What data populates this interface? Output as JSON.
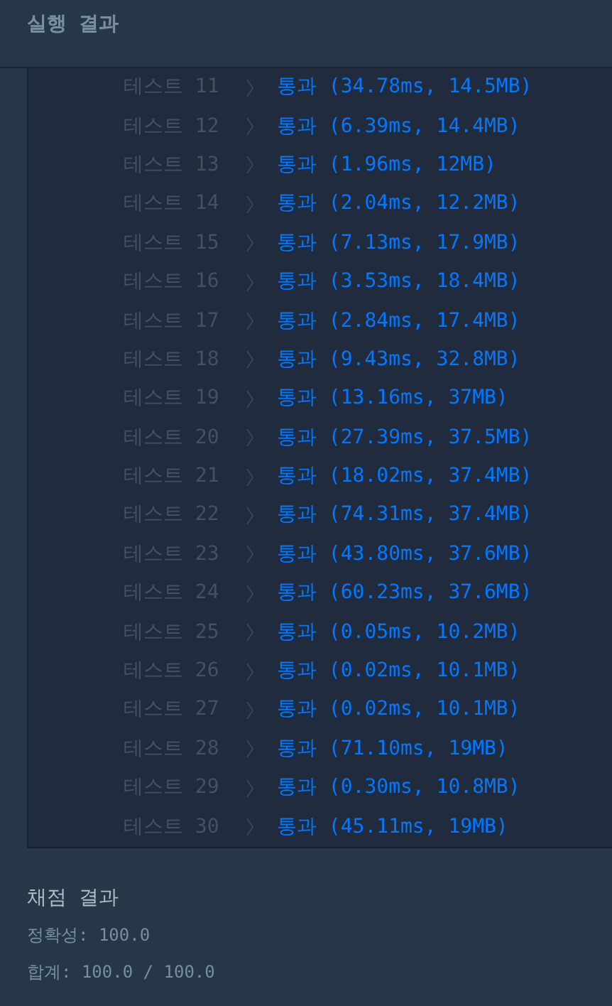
{
  "header": {
    "title": "실행 결과"
  },
  "tests": [
    {
      "label": "테스트 11",
      "result": "통과 (34.78ms, 14.5MB)"
    },
    {
      "label": "테스트 12",
      "result": "통과 (6.39ms, 14.4MB)"
    },
    {
      "label": "테스트 13",
      "result": "통과 (1.96ms, 12MB)"
    },
    {
      "label": "테스트 14",
      "result": "통과 (2.04ms, 12.2MB)"
    },
    {
      "label": "테스트 15",
      "result": "통과 (7.13ms, 17.9MB)"
    },
    {
      "label": "테스트 16",
      "result": "통과 (3.53ms, 18.4MB)"
    },
    {
      "label": "테스트 17",
      "result": "통과 (2.84ms, 17.4MB)"
    },
    {
      "label": "테스트 18",
      "result": "통과 (9.43ms, 32.8MB)"
    },
    {
      "label": "테스트 19",
      "result": "통과 (13.16ms, 37MB)"
    },
    {
      "label": "테스트 20",
      "result": "통과 (27.39ms, 37.5MB)"
    },
    {
      "label": "테스트 21",
      "result": "통과 (18.02ms, 37.4MB)"
    },
    {
      "label": "테스트 22",
      "result": "통과 (74.31ms, 37.4MB)"
    },
    {
      "label": "테스트 23",
      "result": "통과 (43.80ms, 37.6MB)"
    },
    {
      "label": "테스트 24",
      "result": "통과 (60.23ms, 37.6MB)"
    },
    {
      "label": "테스트 25",
      "result": "통과 (0.05ms, 10.2MB)"
    },
    {
      "label": "테스트 26",
      "result": "통과 (0.02ms, 10.1MB)"
    },
    {
      "label": "테스트 27",
      "result": "통과 (0.02ms, 10.1MB)"
    },
    {
      "label": "테스트 28",
      "result": "통과 (71.10ms, 19MB)"
    },
    {
      "label": "테스트 29",
      "result": "통과 (0.30ms, 10.8MB)"
    },
    {
      "label": "테스트 30",
      "result": "통과 (45.11ms, 19MB)"
    }
  ],
  "grading": {
    "title": "채점 결과",
    "lines": [
      "정확성: 100.0",
      "합계: 100.0 / 100.0"
    ]
  }
}
